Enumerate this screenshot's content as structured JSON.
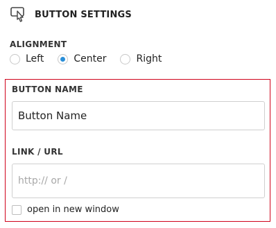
{
  "header": {
    "icon": "pointer-cursor-button-icon",
    "title": "BUTTON SETTINGS"
  },
  "alignment": {
    "label": "ALIGNMENT",
    "options": [
      {
        "label": "Left",
        "checked": false
      },
      {
        "label": "Center",
        "checked": true
      },
      {
        "label": "Right",
        "checked": false
      }
    ]
  },
  "button_name": {
    "label": "BUTTON NAME",
    "value": "Button Name"
  },
  "link": {
    "label": "LINK / URL",
    "placeholder": "http:// or /",
    "value": ""
  },
  "new_window": {
    "label": "open in new window",
    "checked": false
  },
  "colors": {
    "accent": "#2a8fd8",
    "panel_border": "#d0021b"
  }
}
